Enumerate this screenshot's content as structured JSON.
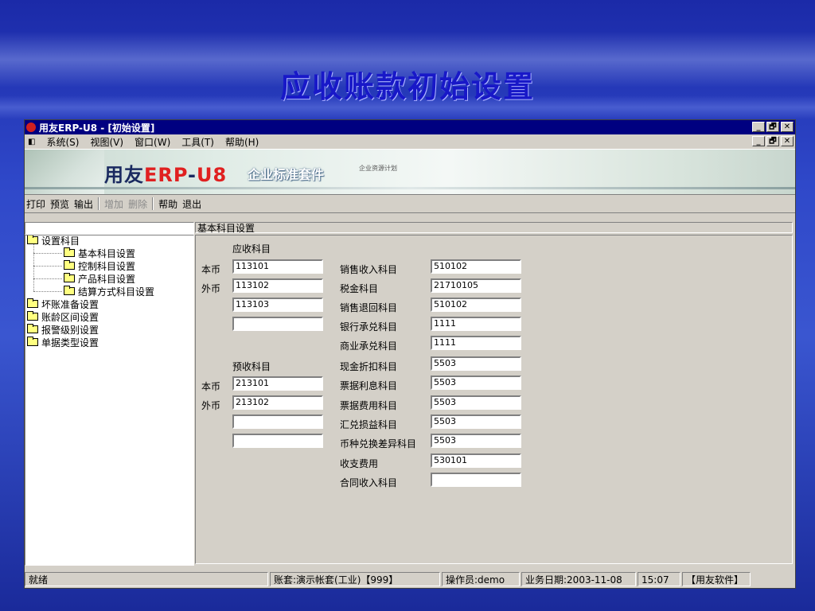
{
  "slide_title": "应收账款初始设置",
  "window": {
    "title": "用友ERP-U8 - [初始设置]",
    "controls": [
      "_",
      "🗗",
      "✕"
    ]
  },
  "menu": {
    "items": [
      "系统(S)",
      "视图(V)",
      "窗口(W)",
      "工具(T)",
      "帮助(H)"
    ]
  },
  "banner": {
    "logo_prefix": "用友",
    "logo_erp": "ERP",
    "logo_dash": "-",
    "logo_u8": "U8",
    "suite": "企业标准套件",
    "small": "企业资源计划"
  },
  "toolbar": {
    "print": "打印",
    "preview": "预览",
    "export": "输出",
    "add": "增加",
    "delete": "删除",
    "help": "帮助",
    "exit": "退出"
  },
  "tree": {
    "root": "设置科目",
    "children": [
      "基本科目设置",
      "控制科目设置",
      "产品科目设置",
      "结算方式科目设置"
    ],
    "others": [
      "坏账准备设置",
      "账龄区间设置",
      "报警级别设置",
      "单据类型设置"
    ]
  },
  "panel": {
    "title": "基本科目设置",
    "receivable_header": "应收科目",
    "prepaid_header": "预收科目",
    "local_currency": "本币",
    "foreign_currency": "外币",
    "receivable_values": [
      "113101",
      "113102",
      "113103",
      ""
    ],
    "prepaid_values": [
      "213101",
      "213102",
      "",
      ""
    ],
    "right_fields": [
      {
        "label": "销售收入科目",
        "value": "510102"
      },
      {
        "label": "税金科目",
        "value": "21710105"
      },
      {
        "label": "销售退回科目",
        "value": "510102"
      },
      {
        "label": "银行承兑科目",
        "value": "1111"
      },
      {
        "label": "商业承兑科目",
        "value": "1111"
      },
      {
        "label": "现金折扣科目",
        "value": "5503"
      },
      {
        "label": "票据利息科目",
        "value": "5503"
      },
      {
        "label": "票据费用科目",
        "value": "5503"
      },
      {
        "label": "汇兑损益科目",
        "value": "5503"
      },
      {
        "label": "币种兑换差异科目",
        "value": "5503"
      },
      {
        "label": "收支费用",
        "value": "530101"
      },
      {
        "label": "合同收入科目",
        "value": ""
      }
    ]
  },
  "status": {
    "ready": "就绪",
    "account": "账套:演示帐套(工业)【999】",
    "operator": "操作员:demo",
    "date": "业务日期:2003-11-08",
    "time": "15:07",
    "brand": "【用友软件】"
  }
}
